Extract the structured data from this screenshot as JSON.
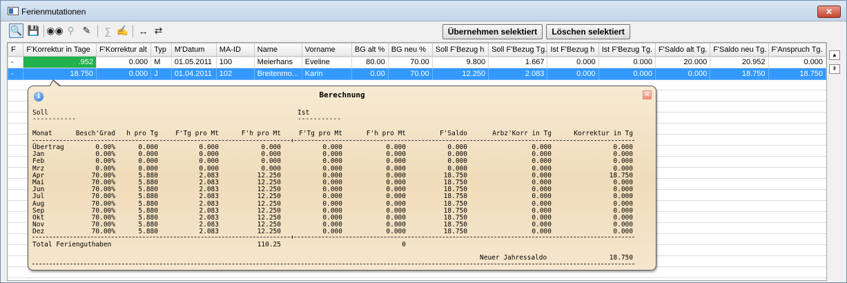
{
  "window": {
    "title": "Ferienmutationen",
    "close_glyph": "✕"
  },
  "toolbar": {
    "icons": [
      "search-icon",
      "save-icon",
      "binoculars-icon",
      "zoom-icon",
      "brush-icon",
      "sum-icon",
      "edit-icon",
      "expand-width-icon",
      "fit-width-icon"
    ],
    "apply_label": "Übernehmen selektiert",
    "delete_label": "Löschen selektiert"
  },
  "grid": {
    "columns": [
      "F",
      "F'Korrektur in Tage",
      "F'Korrektur alt",
      "Typ",
      "M'Datum",
      "MA-ID",
      "Name",
      "Vorname",
      "BG alt %",
      "BG neu %",
      "Soll F'Bezug h",
      "Soll F'Bezug Tg.",
      "Ist F'Bezug h",
      "Ist F'Bezug Tg.",
      "F'Saldo alt Tg.",
      "F'Saldo neu Tg.",
      "F'Anspruch Tg."
    ],
    "rows": [
      {
        "f": "-",
        "korr": ".952",
        "korr_alt": "0.000",
        "typ": "M",
        "datum": "01.05.2011",
        "maid": "100",
        "name": "Meierhans",
        "vorname": "Eveline",
        "bg_alt": "80.00",
        "bg_neu": "70.00",
        "soll_h": "9.800",
        "soll_tg": "1.667",
        "ist_h": "0.000",
        "ist_tg": "0.000",
        "saldo_alt": "20.000",
        "saldo_neu": "20.952",
        "anspruch": "0.000"
      },
      {
        "f": "-",
        "korr": "18.750",
        "korr_alt": "0.000",
        "typ": "J",
        "datum": "01.04.2011",
        "maid": "102",
        "name": "Breitenmo...",
        "vorname": "Karin",
        "bg_alt": "0.00",
        "bg_neu": "70.00",
        "soll_h": "12.250",
        "soll_tg": "2.083",
        "ist_h": "0.000",
        "ist_tg": "0.000",
        "saldo_alt": "0.000",
        "saldo_neu": "18.750",
        "anspruch": "18.750"
      }
    ]
  },
  "scroll": {
    "up": "▲",
    "top": "⇞"
  },
  "popup": {
    "title": "Berechnung",
    "info_glyph": "i",
    "close_glyph": "✕",
    "soll_label": "Soll",
    "ist_label": "Ist",
    "underline_soll": "-----------",
    "underline_ist": "-----------",
    "headers": [
      "Monat",
      "Besch'Grad",
      "h pro Tg",
      "F'Tg pro Mt",
      "F'h pro Mt",
      "F'Tg pro Mt",
      "F'h pro Mt",
      "F'Saldo",
      "Arbz'Korr in Tg",
      "Korrektur in Tg"
    ],
    "rows": [
      [
        "Übertrag",
        "0.00%",
        "0.000",
        "0.000",
        "0.000",
        "0.000",
        "0.000",
        "0.000",
        "0.000",
        "0.000"
      ],
      [
        "Jan",
        "0.00%",
        "0.000",
        "0.000",
        "0.000",
        "0.000",
        "0.000",
        "0.000",
        "0.000",
        "0.000"
      ],
      [
        "Feb",
        "0.00%",
        "0.000",
        "0.000",
        "0.000",
        "0.000",
        "0.000",
        "0.000",
        "0.000",
        "0.000"
      ],
      [
        "Mrz",
        "0.00%",
        "0.000",
        "0.000",
        "0.000",
        "0.000",
        "0.000",
        "0.000",
        "0.000",
        "0.000"
      ],
      [
        "Apr",
        "70.00%",
        "5.880",
        "2.083",
        "12.250",
        "0.000",
        "0.000",
        "18.750",
        "0.000",
        "18.750"
      ],
      [
        "Mai",
        "70.00%",
        "5.880",
        "2.083",
        "12.250",
        "0.000",
        "0.000",
        "18.750",
        "0.000",
        "0.000"
      ],
      [
        "Jun",
        "70.00%",
        "5.880",
        "2.083",
        "12.250",
        "0.000",
        "0.000",
        "18.750",
        "0.000",
        "0.000"
      ],
      [
        "Jul",
        "70.00%",
        "5.880",
        "2.083",
        "12.250",
        "0.000",
        "0.000",
        "18.750",
        "0.000",
        "0.000"
      ],
      [
        "Aug",
        "70.00%",
        "5.880",
        "2.083",
        "12.250",
        "0.000",
        "0.000",
        "18.750",
        "0.000",
        "0.000"
      ],
      [
        "Sep",
        "70.00%",
        "5.880",
        "2.083",
        "12.250",
        "0.000",
        "0.000",
        "18.750",
        "0.000",
        "0.000"
      ],
      [
        "Okt",
        "70.00%",
        "5.880",
        "2.083",
        "12.250",
        "0.000",
        "0.000",
        "18.750",
        "0.000",
        "0.000"
      ],
      [
        "Nov",
        "70.00%",
        "5.880",
        "2.083",
        "12.250",
        "0.000",
        "0.000",
        "18.750",
        "0.000",
        "0.000"
      ],
      [
        "Dez",
        "70.00%",
        "5.880",
        "2.083",
        "12.250",
        "0.000",
        "0.000",
        "18.750",
        "0.000",
        "0.000"
      ]
    ],
    "total_label": "Total Ferienguthaben",
    "total_soll": "110.25",
    "total_ist": "0",
    "jahressaldo_label": "Neuer Jahressaldo",
    "jahressaldo_value": "18.750"
  }
}
